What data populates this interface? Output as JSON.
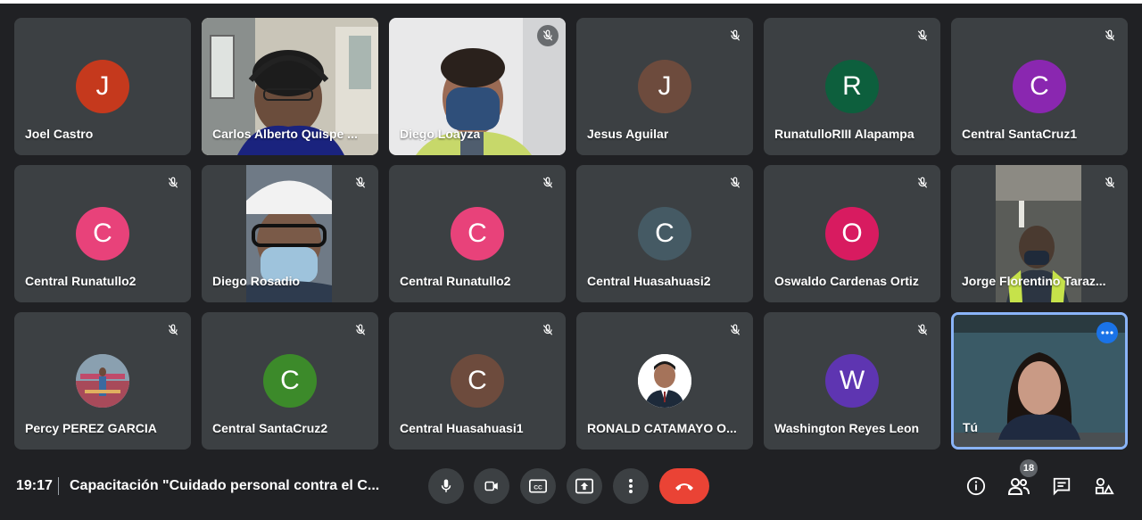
{
  "meeting": {
    "time": "19:17",
    "title": "Capacitación \"Cuidado personal contra el C...",
    "participants_count": "18"
  },
  "tiles": [
    {
      "name": "Joel Castro",
      "initial": "J",
      "color": "#c5391d"
    },
    {
      "name": "Carlos Alberto Quispe ..."
    },
    {
      "name": "Diego Loayza"
    },
    {
      "name": "Jesus Aguilar",
      "initial": "J",
      "color": "#6d4b3d"
    },
    {
      "name": "RunatulloRIII Alapampa",
      "initial": "R",
      "color": "#0d5f3d"
    },
    {
      "name": "Central SantaCruz1",
      "initial": "C",
      "color": "#8a27b0"
    },
    {
      "name": "Central Runatullo2",
      "initial": "C",
      "color": "#e8427a"
    },
    {
      "name": "Diego Rosadio"
    },
    {
      "name": "Central Runatullo2",
      "initial": "C",
      "color": "#e8427a"
    },
    {
      "name": "Central Huasahuasi2",
      "initial": "C",
      "color": "#455a64"
    },
    {
      "name": "Oswaldo Cardenas Ortiz",
      "initial": "O",
      "color": "#d81b60"
    },
    {
      "name": "Jorge Florentino Taraz..."
    },
    {
      "name": "Percy PEREZ GARCIA"
    },
    {
      "name": "Central SantaCruz2",
      "initial": "C",
      "color": "#3c8a2a"
    },
    {
      "name": "Central Huasahuasi1",
      "initial": "C",
      "color": "#6d4b3d"
    },
    {
      "name": "RONALD CATAMAYO O..."
    },
    {
      "name": "Washington Reyes Leon",
      "initial": "W",
      "color": "#5e35b1"
    },
    {
      "name": "Tú"
    }
  ],
  "icons": {
    "mic": "mic-icon",
    "camera": "camera-icon",
    "captions": "captions-icon",
    "present": "present-icon",
    "more": "more-vert-icon",
    "hangup": "hangup-icon",
    "info": "info-icon",
    "people": "people-icon",
    "chat": "chat-icon",
    "activities": "activities-icon"
  },
  "colors": {
    "background": "#202124",
    "tile": "#3c4043",
    "hangup": "#ea4335",
    "self_border": "#8ab4f8"
  }
}
